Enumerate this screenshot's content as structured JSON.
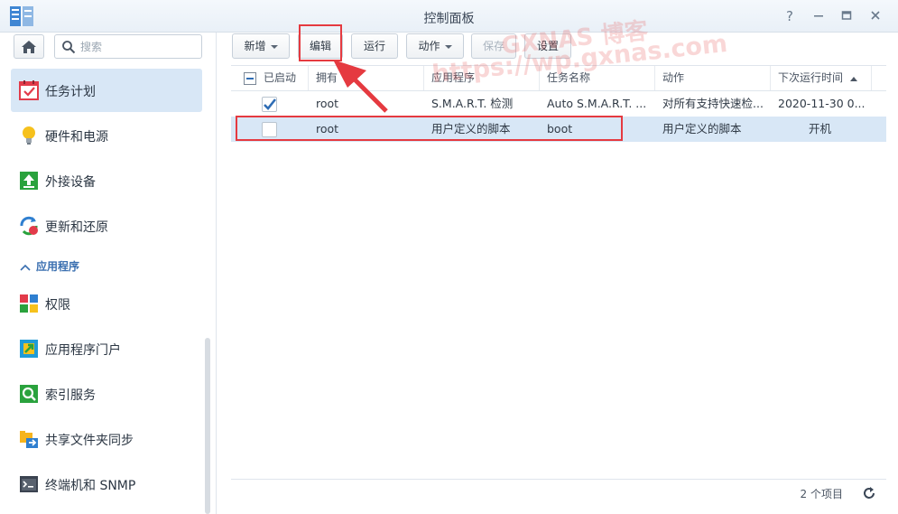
{
  "window": {
    "title": "控制面板",
    "help_icon": "question-mark-icon",
    "minimize_icon": "minimize-icon",
    "maximize_icon": "maximize-icon",
    "close_icon": "close-icon"
  },
  "watermark": {
    "line1": "GXNAS 博客",
    "line2": "https://wp.gxnas.com"
  },
  "sidebar": {
    "search_placeholder": "搜索",
    "items": [
      {
        "label": "任务计划",
        "icon": "task-calendar-icon",
        "active": true
      },
      {
        "label": "硬件和电源",
        "icon": "lightbulb-icon"
      },
      {
        "label": "外接设备",
        "icon": "external-device-icon"
      },
      {
        "label": "更新和还原",
        "icon": "update-restore-icon"
      }
    ],
    "section_label": "应用程序",
    "app_items": [
      {
        "label": "权限",
        "icon": "permissions-icon"
      },
      {
        "label": "应用程序门户",
        "icon": "app-portal-icon"
      },
      {
        "label": "索引服务",
        "icon": "index-service-icon"
      },
      {
        "label": "共享文件夹同步",
        "icon": "shared-folder-sync-icon"
      },
      {
        "label": "终端机和 SNMP",
        "icon": "terminal-icon"
      }
    ]
  },
  "toolbar": {
    "create": "新增",
    "edit": "编辑",
    "run": "运行",
    "action": "动作",
    "save": "保存",
    "settings": "设置"
  },
  "table": {
    "headers": {
      "enabled": "已启动",
      "owner": "拥有",
      "application": "应用程序",
      "task_name": "任务名称",
      "action": "动作",
      "next_run": "下次运行时间"
    },
    "rows": [
      {
        "enabled": true,
        "owner": "root",
        "application": "S.M.A.R.T. 检测",
        "task_name": "Auto S.M.A.R.T. ...",
        "action": "对所有支持快速检...",
        "next_run": "2020-11-30 0..."
      },
      {
        "enabled": false,
        "owner": "root",
        "application": "用户定义的脚本",
        "task_name": "boot",
        "action": "用户定义的脚本",
        "next_run": "开机"
      }
    ]
  },
  "footer": {
    "count": "2 个项目"
  },
  "colors": {
    "accent": "#2f6db5",
    "selection": "#d8e7f6",
    "annotation": "#e53a40"
  }
}
